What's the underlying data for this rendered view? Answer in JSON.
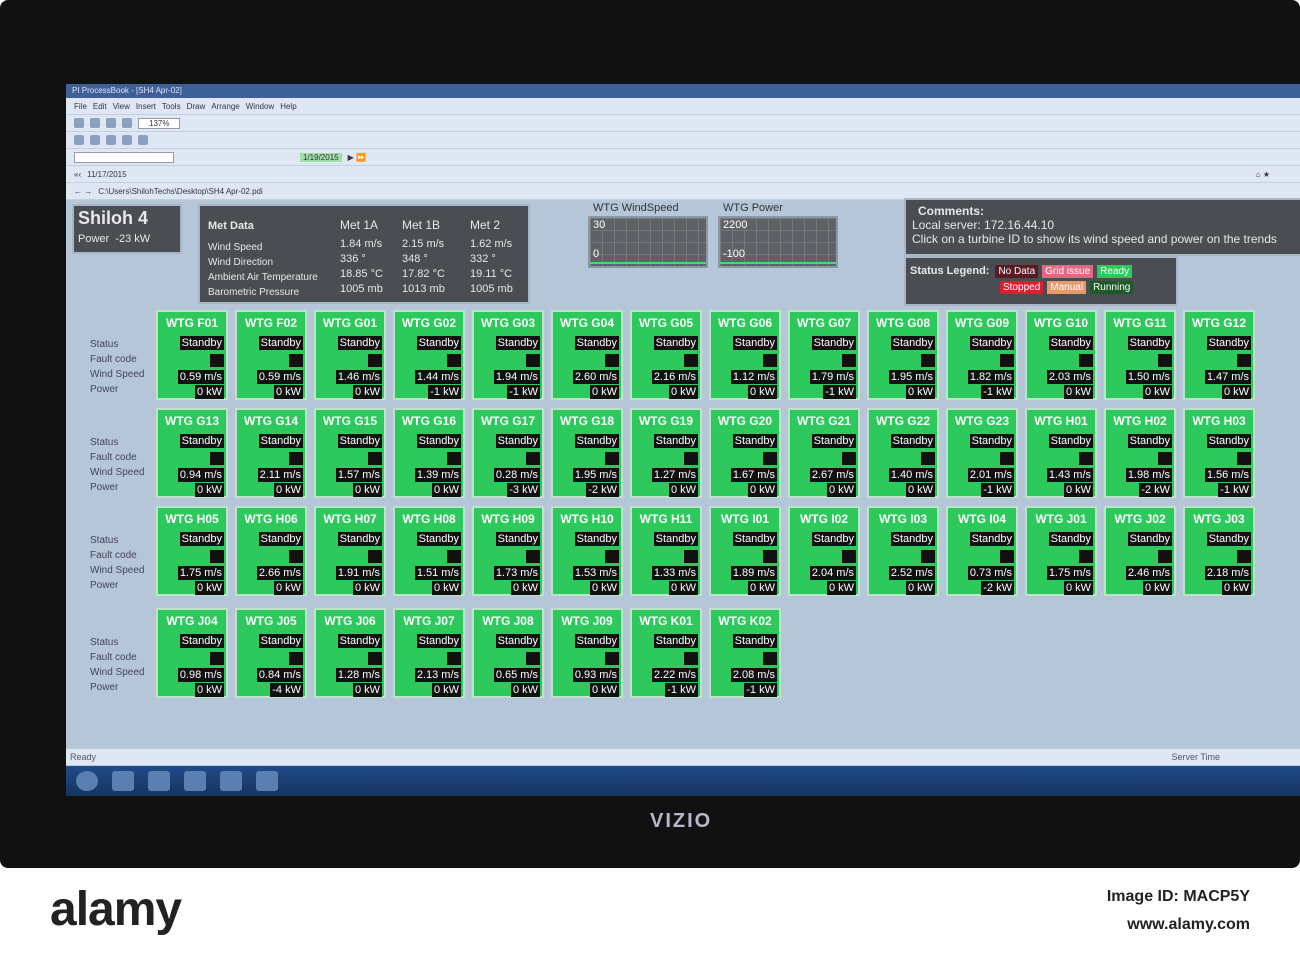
{
  "app": {
    "title": "PI ProcessBook - [SH4 Apr-02]",
    "menu": [
      "File",
      "Edit",
      "View",
      "Insert",
      "Tools",
      "Draw",
      "Arrange",
      "Window",
      "Help"
    ],
    "zoom": "137%",
    "time_start": "11/17/2015",
    "time_end": "1/19/2015",
    "path": "C:\\Users\\ShilohTechs\\Desktop\\SH4 Apr-02.pdi",
    "status_left": "Ready",
    "status_right": "Server Time"
  },
  "site": {
    "name": "Shiloh 4",
    "power_label": "Power",
    "power_value": "-23 kW"
  },
  "met": {
    "title": "Met Data",
    "columns": [
      "Met 1A",
      "Met 1B",
      "Met 2"
    ],
    "rows": [
      {
        "label": "Wind Speed",
        "values": [
          "1.84 m/s",
          "2.15 m/s",
          "1.62 m/s"
        ]
      },
      {
        "label": "Wind Direction",
        "values": [
          "336 °",
          "348 °",
          "332 °"
        ]
      },
      {
        "label": "Ambient Air Temperature",
        "values": [
          "18.85 °C",
          "17.82 °C",
          "19.11 °C"
        ]
      },
      {
        "label": "Barometric Pressure",
        "values": [
          "1005 mb",
          "1013 mb",
          "1005 mb"
        ]
      }
    ]
  },
  "trends": [
    {
      "title": "WTG WindSpeed",
      "max": "30",
      "min": "0"
    },
    {
      "title": "WTG Power",
      "max": "2200",
      "min": "-100"
    }
  ],
  "comments": {
    "title": "Comments:",
    "line1": "Local server: 172.16.44.10",
    "line2": "Click on a turbine ID to show its wind speed and power on the trends"
  },
  "legend": {
    "title": "Status Legend:",
    "items": [
      {
        "label": "No Data",
        "color": "#5a1a22"
      },
      {
        "label": "Grid issue",
        "color": "#e06a84"
      },
      {
        "label": "Ready",
        "color": "#2ec95c"
      },
      {
        "label": "Stopped",
        "color": "#d82030"
      },
      {
        "label": "Manual",
        "color": "#e89a6a"
      },
      {
        "label": "Running",
        "color": "#1d5a2a"
      }
    ]
  },
  "row_labels": [
    "Status",
    "Fault code",
    "Wind Speed",
    "Power"
  ],
  "turbine_rows": [
    [
      [
        "WTG F01",
        "0.59 m/s",
        "0 kW"
      ],
      [
        "WTG F02",
        "0.59 m/s",
        "0 kW"
      ],
      [
        "WTG G01",
        "1.46 m/s",
        "0 kW"
      ],
      [
        "WTG G02",
        "1.44 m/s",
        "-1 kW"
      ],
      [
        "WTG G03",
        "1.94 m/s",
        "-1 kW"
      ],
      [
        "WTG G04",
        "2.60 m/s",
        "0 kW"
      ],
      [
        "WTG G05",
        "2.16 m/s",
        "0 kW"
      ],
      [
        "WTG G06",
        "1.12 m/s",
        "0 kW"
      ],
      [
        "WTG G07",
        "1.79 m/s",
        "-1 kW"
      ],
      [
        "WTG G08",
        "1.95 m/s",
        "0 kW"
      ],
      [
        "WTG G09",
        "1.82 m/s",
        "-1 kW"
      ],
      [
        "WTG G10",
        "2.03 m/s",
        "0 kW"
      ],
      [
        "WTG G11",
        "1.50 m/s",
        "0 kW"
      ],
      [
        "WTG G12",
        "1.47 m/s",
        "0 kW"
      ]
    ],
    [
      [
        "WTG G13",
        "0.94 m/s",
        "0 kW"
      ],
      [
        "WTG G14",
        "2.11 m/s",
        "0 kW"
      ],
      [
        "WTG G15",
        "1.57 m/s",
        "0 kW"
      ],
      [
        "WTG G16",
        "1.39 m/s",
        "0 kW"
      ],
      [
        "WTG G17",
        "0.28 m/s",
        "-3 kW"
      ],
      [
        "WTG G18",
        "1.95 m/s",
        "-2 kW"
      ],
      [
        "WTG G19",
        "1.27 m/s",
        "0 kW"
      ],
      [
        "WTG G20",
        "1.67 m/s",
        "0 kW"
      ],
      [
        "WTG G21",
        "2.67 m/s",
        "0 kW"
      ],
      [
        "WTG G22",
        "1.40 m/s",
        "0 kW"
      ],
      [
        "WTG G23",
        "2.01 m/s",
        "-1 kW"
      ],
      [
        "WTG H01",
        "1.43 m/s",
        "0 kW"
      ],
      [
        "WTG H02",
        "1.98 m/s",
        "-2 kW"
      ],
      [
        "WTG H03",
        "1.56 m/s",
        "-1 kW"
      ]
    ],
    [
      [
        "WTG H05",
        "1.75 m/s",
        "0 kW"
      ],
      [
        "WTG H06",
        "2.66 m/s",
        "0 kW"
      ],
      [
        "WTG H07",
        "1.91 m/s",
        "0 kW"
      ],
      [
        "WTG H08",
        "1.51 m/s",
        "0 kW"
      ],
      [
        "WTG H09",
        "1.73 m/s",
        "0 kW"
      ],
      [
        "WTG H10",
        "1.53 m/s",
        "0 kW"
      ],
      [
        "WTG H11",
        "1.33 m/s",
        "0 kW"
      ],
      [
        "WTG I01",
        "1.89 m/s",
        "0 kW"
      ],
      [
        "WTG I02",
        "2.04 m/s",
        "0 kW"
      ],
      [
        "WTG I03",
        "2.52 m/s",
        "0 kW"
      ],
      [
        "WTG I04",
        "0.73 m/s",
        "-2 kW"
      ],
      [
        "WTG J01",
        "1.75 m/s",
        "0 kW"
      ],
      [
        "WTG J02",
        "2.46 m/s",
        "0 kW"
      ],
      [
        "WTG J03",
        "2.18 m/s",
        "0 kW"
      ]
    ],
    [
      [
        "WTG J04",
        "0.98 m/s",
        "0 kW"
      ],
      [
        "WTG J05",
        "0.84 m/s",
        "-4 kW"
      ],
      [
        "WTG J06",
        "1.28 m/s",
        "0 kW"
      ],
      [
        "WTG J07",
        "2.13 m/s",
        "0 kW"
      ],
      [
        "WTG J08",
        "0.65 m/s",
        "0 kW"
      ],
      [
        "WTG J09",
        "0.93 m/s",
        "0 kW"
      ],
      [
        "WTG K01",
        "2.22 m/s",
        "-1 kW"
      ],
      [
        "WTG K02",
        "2.08 m/s",
        "-1 kW"
      ]
    ]
  ],
  "turbine_status": "Standby",
  "monitor_brand": "VIZIO",
  "footer": {
    "brand": "alamy",
    "id": "Image ID: MACP5Y",
    "url": "www.alamy.com"
  }
}
